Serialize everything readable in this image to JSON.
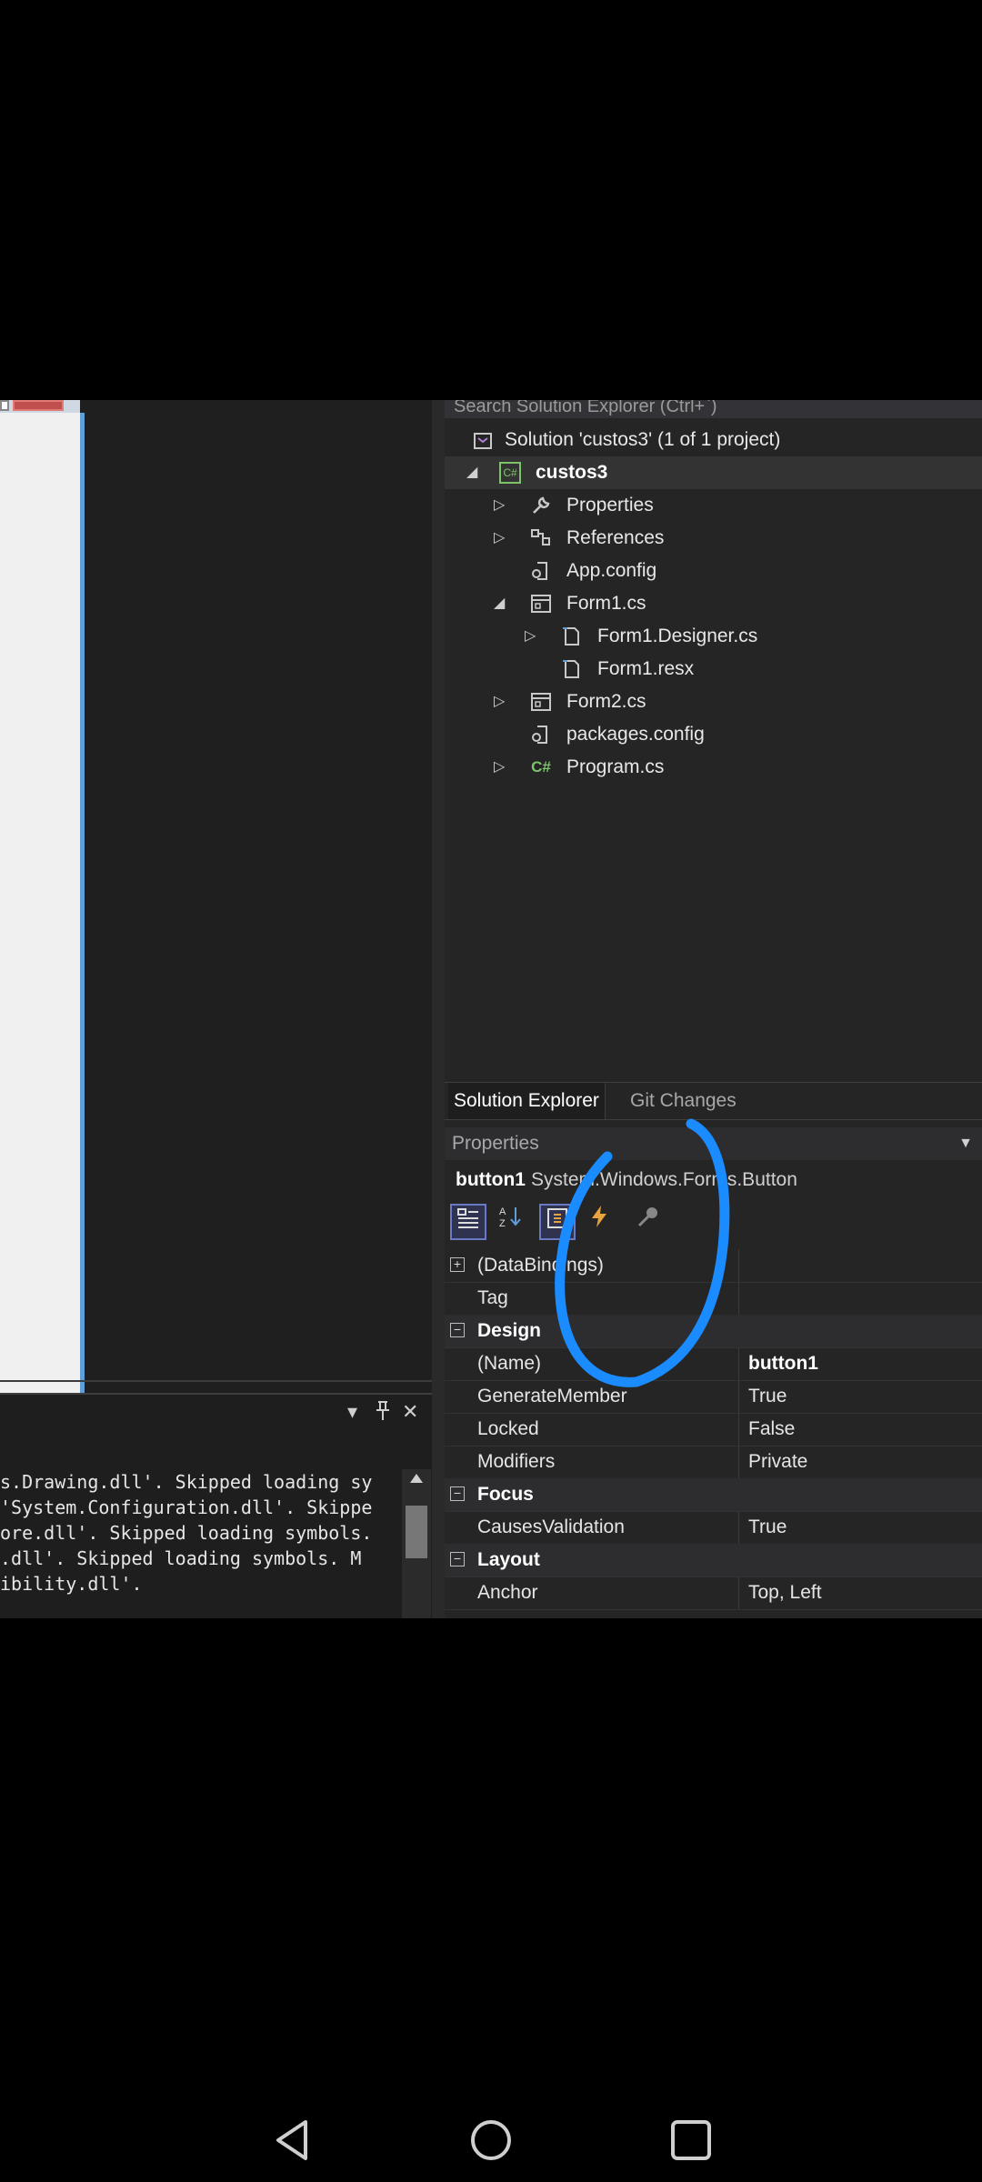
{
  "colors": {
    "accent_blue": "#1a8cff",
    "form_border": "#5f9ed6",
    "csharp_green": "#7cc46a"
  },
  "solution_explorer": {
    "search_placeholder": "Search Solution Explorer (Ctrl+`)",
    "items": [
      {
        "label": "Solution 'custos3' (1 of 1 project)",
        "icon": "solution-icon",
        "bold": false
      },
      {
        "label": "custos3",
        "icon": "csharp-project-icon",
        "bold": true
      },
      {
        "label": "Properties",
        "icon": "wrench-icon"
      },
      {
        "label": "References",
        "icon": "references-icon"
      },
      {
        "label": "App.config",
        "icon": "config-file-icon"
      },
      {
        "label": "Form1.cs",
        "icon": "form-icon"
      },
      {
        "label": "Form1.Designer.cs",
        "icon": "file-icon"
      },
      {
        "label": "Form1.resx",
        "icon": "file-icon"
      },
      {
        "label": "Form2.cs",
        "icon": "form-icon"
      },
      {
        "label": "packages.config",
        "icon": "config-file-icon"
      },
      {
        "label": "Program.cs",
        "icon": "csharp-file-icon"
      }
    ],
    "tabs": [
      {
        "label": "Solution Explorer"
      },
      {
        "label": "Git Changes"
      }
    ]
  },
  "properties": {
    "title": "Properties",
    "object_name": "button1",
    "object_type": "System.Windows.Forms.Button",
    "toolbar": [
      "categorized-icon",
      "alphabetical-icon",
      "properties-icon",
      "events-icon",
      "property-pages-icon"
    ],
    "rows": [
      {
        "kind": "expandable",
        "name": "(DataBindings)",
        "value": ""
      },
      {
        "kind": "prop",
        "name": "Tag",
        "value": ""
      },
      {
        "kind": "category",
        "name": "Design"
      },
      {
        "kind": "prop",
        "name": "(Name)",
        "value": "button1",
        "bold": true
      },
      {
        "kind": "prop",
        "name": "GenerateMember",
        "value": "True"
      },
      {
        "kind": "prop",
        "name": "Locked",
        "value": "False"
      },
      {
        "kind": "prop",
        "name": "Modifiers",
        "value": "Private"
      },
      {
        "kind": "category",
        "name": "Focus"
      },
      {
        "kind": "prop",
        "name": "CausesValidation",
        "value": "True"
      },
      {
        "kind": "category",
        "name": "Layout"
      },
      {
        "kind": "prop",
        "name": "Anchor",
        "value": "Top, Left"
      }
    ]
  },
  "output": {
    "controls": {
      "dropdown": "▾",
      "pin": "🖈",
      "close": "✕"
    },
    "lines": [
      "s.Drawing.dll'. Skipped loading sy",
      "'System.Configuration.dll'. Skippe",
      "ore.dll'. Skipped loading symbols.",
      ".dll'. Skipped loading symbols. M",
      "ibility.dll'."
    ]
  },
  "navbar": {
    "buttons": [
      "back-icon",
      "home-icon",
      "recents-icon"
    ]
  }
}
